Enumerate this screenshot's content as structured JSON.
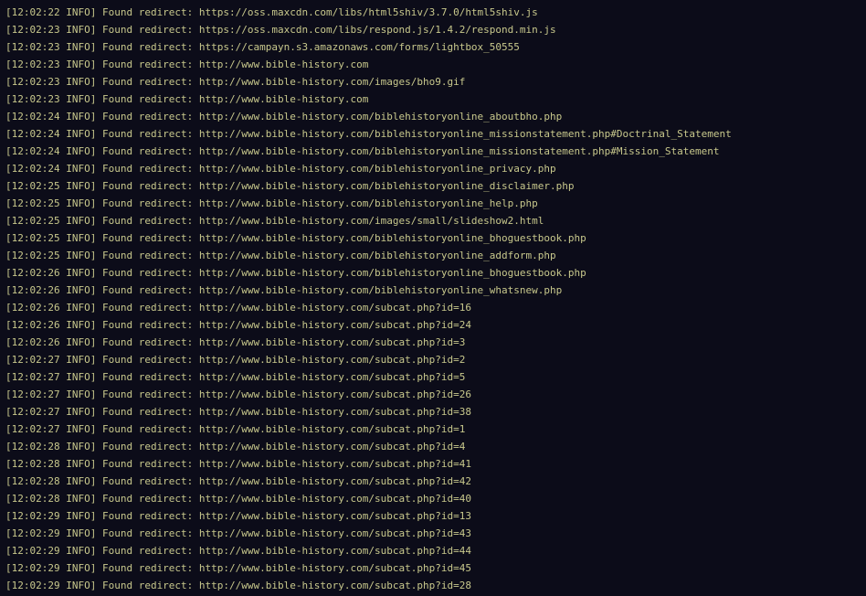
{
  "terminal": {
    "lines": [
      "[12:02:22 INFO] Found redirect: https://oss.maxcdn.com/libs/html5shiv/3.7.0/html5shiv.js",
      "[12:02:23 INFO] Found redirect: https://oss.maxcdn.com/libs/respond.js/1.4.2/respond.min.js",
      "[12:02:23 INFO] Found redirect: https://campayn.s3.amazonaws.com/forms/lightbox_50555",
      "[12:02:23 INFO] Found redirect: http://www.bible-history.com",
      "[12:02:23 INFO] Found redirect: http://www.bible-history.com/images/bho9.gif",
      "[12:02:23 INFO] Found redirect: http://www.bible-history.com",
      "[12:02:24 INFO] Found redirect: http://www.bible-history.com/biblehistoryonline_aboutbho.php",
      "[12:02:24 INFO] Found redirect: http://www.bible-history.com/biblehistoryonline_missionstatement.php#Doctrinal_Statement",
      "[12:02:24 INFO] Found redirect: http://www.bible-history.com/biblehistoryonline_missionstatement.php#Mission_Statement",
      "[12:02:24 INFO] Found redirect: http://www.bible-history.com/biblehistoryonline_privacy.php",
      "[12:02:25 INFO] Found redirect: http://www.bible-history.com/biblehistoryonline_disclaimer.php",
      "[12:02:25 INFO] Found redirect: http://www.bible-history.com/biblehistoryonline_help.php",
      "[12:02:25 INFO] Found redirect: http://www.bible-history.com/images/small/slideshow2.html",
      "[12:02:25 INFO] Found redirect: http://www.bible-history.com/biblehistoryonline_bhoguestbook.php",
      "[12:02:25 INFO] Found redirect: http://www.bible-history.com/biblehistoryonline_addform.php",
      "[12:02:26 INFO] Found redirect: http://www.bible-history.com/biblehistoryonline_bhoguestbook.php",
      "[12:02:26 INFO] Found redirect: http://www.bible-history.com/biblehistoryonline_whatsnew.php",
      "[12:02:26 INFO] Found redirect: http://www.bible-history.com/subcat.php?id=16",
      "[12:02:26 INFO] Found redirect: http://www.bible-history.com/subcat.php?id=24",
      "[12:02:26 INFO] Found redirect: http://www.bible-history.com/subcat.php?id=3",
      "[12:02:27 INFO] Found redirect: http://www.bible-history.com/subcat.php?id=2",
      "[12:02:27 INFO] Found redirect: http://www.bible-history.com/subcat.php?id=5",
      "[12:02:27 INFO] Found redirect: http://www.bible-history.com/subcat.php?id=26",
      "[12:02:27 INFO] Found redirect: http://www.bible-history.com/subcat.php?id=38",
      "[12:02:27 INFO] Found redirect: http://www.bible-history.com/subcat.php?id=1",
      "[12:02:28 INFO] Found redirect: http://www.bible-history.com/subcat.php?id=4",
      "[12:02:28 INFO] Found redirect: http://www.bible-history.com/subcat.php?id=41",
      "[12:02:28 INFO] Found redirect: http://www.bible-history.com/subcat.php?id=42",
      "[12:02:28 INFO] Found redirect: http://www.bible-history.com/subcat.php?id=40",
      "[12:02:29 INFO] Found redirect: http://www.bible-history.com/subcat.php?id=13",
      "[12:02:29 INFO] Found redirect: http://www.bible-history.com/subcat.php?id=43",
      "[12:02:29 INFO] Found redirect: http://www.bible-history.com/subcat.php?id=44",
      "[12:02:29 INFO] Found redirect: http://www.bible-history.com/subcat.php?id=45",
      "[12:02:29 INFO] Found redirect: http://www.bible-history.com/subcat.php?id=28"
    ]
  },
  "colors": {
    "background": "#0c0c19",
    "text": "#c8c88c"
  }
}
